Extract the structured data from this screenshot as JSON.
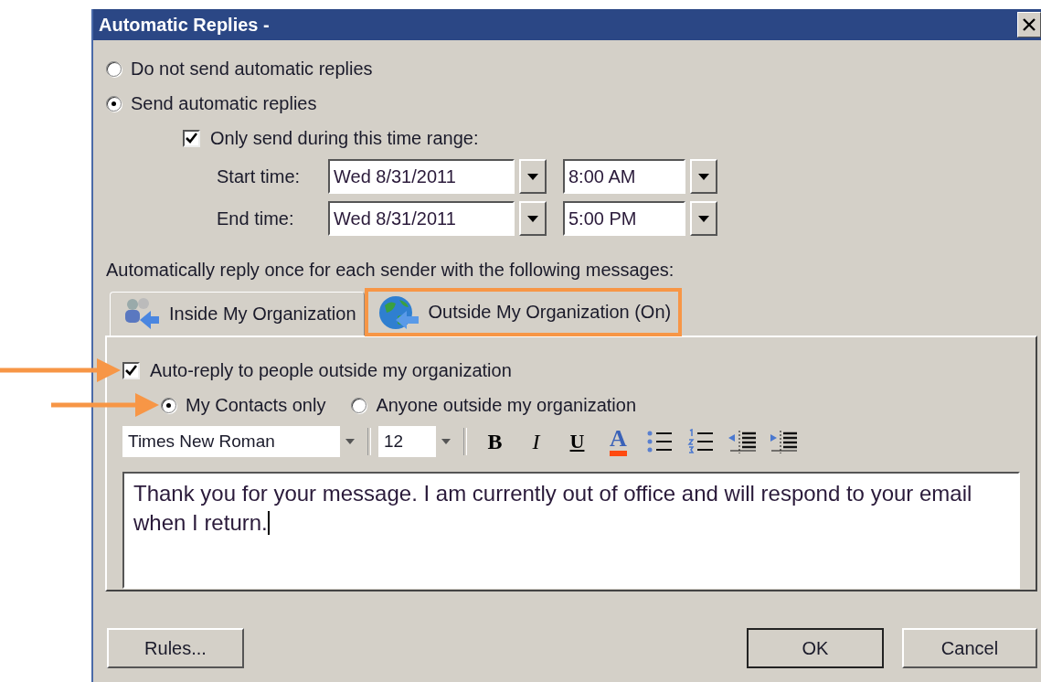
{
  "window": {
    "title": "Automatic Replies -"
  },
  "reply_mode": [
    {
      "label": "Do not send automatic replies",
      "selected": false
    },
    {
      "label": "Send automatic replies",
      "selected": true
    }
  ],
  "time_range": {
    "label": "Only send during this time range:",
    "checked": true
  },
  "times": [
    {
      "label": "Start time:",
      "date": "Wed 8/31/2011",
      "time": "8:00 AM"
    },
    {
      "label": "End time:",
      "date": "Wed 8/31/2011",
      "time": "5:00 PM"
    }
  ],
  "instructions": "Automatically reply once for each sender with the following messages:",
  "tabs": [
    {
      "label": "Inside My Organization",
      "selected": false,
      "highlighted": false
    },
    {
      "label": "Outside My Organization (On)",
      "selected": true,
      "highlighted": true
    }
  ],
  "outside": {
    "auto_reply": {
      "label": "Auto-reply to people outside my organization",
      "checked": true,
      "annotated": true
    },
    "audience": [
      {
        "label": "My Contacts only",
        "selected": true,
        "annotated": true
      },
      {
        "label": "Anyone outside my organization",
        "selected": false,
        "annotated": false
      }
    ]
  },
  "format_toolbar": {
    "font": "Times New Roman",
    "size": "12",
    "tools": [
      {
        "kind": "bold",
        "label": "B"
      },
      {
        "kind": "italic",
        "label": "I"
      },
      {
        "kind": "underline",
        "label": "U"
      },
      {
        "kind": "font-color",
        "label": "A"
      },
      {
        "kind": "bullets"
      },
      {
        "kind": "numbering"
      },
      {
        "kind": "outdent"
      },
      {
        "kind": "indent"
      }
    ]
  },
  "message": "Thank you for your message. I am currently out of office and will respond to your email when I return.",
  "buttons": [
    {
      "label": "Rules...",
      "default": false
    },
    {
      "label": "OK",
      "default": true
    },
    {
      "label": "Cancel",
      "default": false
    }
  ]
}
